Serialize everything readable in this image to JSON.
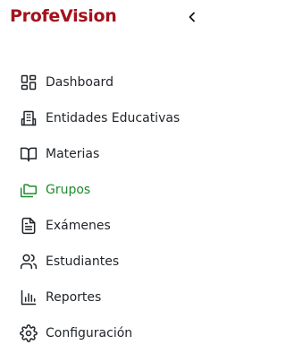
{
  "app": {
    "brand": "ProfeVision",
    "brand_color": "#a3121c"
  },
  "header": {
    "collapse_icon": "chevron-left-icon"
  },
  "sidebar": {
    "accent_color": "#1e8a2e",
    "items": [
      {
        "label": "Dashboard",
        "icon": "dashboard-icon",
        "active": false
      },
      {
        "label": "Entidades Educativas",
        "icon": "building-icon",
        "active": false
      },
      {
        "label": "Materias",
        "icon": "book-open-icon",
        "active": false
      },
      {
        "label": "Grupos",
        "icon": "folders-icon",
        "active": true
      },
      {
        "label": "Exámenes",
        "icon": "file-text-icon",
        "active": false
      },
      {
        "label": "Estudiantes",
        "icon": "users-icon",
        "active": false
      },
      {
        "label": "Reportes",
        "icon": "bar-chart-icon",
        "active": false
      },
      {
        "label": "Configuración",
        "icon": "gear-icon",
        "active": false
      }
    ]
  }
}
